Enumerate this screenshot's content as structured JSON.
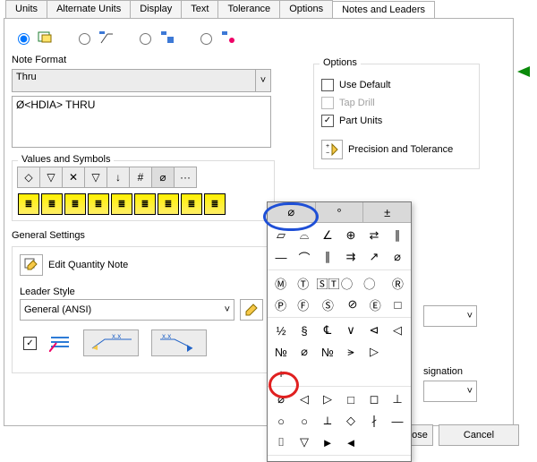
{
  "tabs": [
    "Units",
    "Alternate Units",
    "Display",
    "Text",
    "Tolerance",
    "Options",
    "Notes and Leaders"
  ],
  "active_tab": 6,
  "noteFormat": {
    "legend": "Note Format",
    "value": "Thru",
    "multiline": "Ø<HDIA> THRU"
  },
  "valuesSymbols": {
    "legend": "Values and Symbols",
    "top": [
      "◇",
      "▽",
      "✕",
      "▽",
      "↓",
      "#",
      "⌀",
      "···"
    ],
    "yellow": [
      "≡",
      "≡",
      "≡",
      "≡",
      "≡",
      "≡",
      "≡",
      "≡",
      "≡"
    ]
  },
  "generalSettings": {
    "legend": "General Settings",
    "editQty": "Edit Quantity Note",
    "leaderStyleLabel": "Leader Style",
    "leaderStyleValue": "General (ANSI)",
    "arrow1": "x.x",
    "arrow2": "x.x"
  },
  "options": {
    "legend": "Options",
    "useDefault": "Use Default",
    "tapDrill": "Tap Drill",
    "partUnits": "Part Units",
    "precTol": "Precision and Tolerance"
  },
  "palette": {
    "tabs": [
      "⌀",
      "°",
      "±"
    ],
    "rows": [
      [
        "▱",
        "⌓",
        "∠",
        "⊕",
        "⇄",
        "∥"
      ],
      [
        "—",
        "⌒",
        "∥",
        "⇉",
        "↗",
        "⌀"
      ],
      [
        "Ⓜ",
        "Ⓣ",
        "🅂🅃",
        "⃝",
        "⃝",
        "Ⓡ"
      ],
      [
        "Ⓟ",
        "Ⓕ",
        "Ⓢ",
        "⊘",
        "Ⓔ",
        "□"
      ],
      [
        "½",
        "§",
        "℄",
        "∨",
        "⊲",
        "◁"
      ],
      [
        "№",
        "⌀",
        "№",
        "⪫",
        "▷",
        ""
      ],
      [
        "+",
        "",
        "",
        "",
        "",
        ""
      ],
      [
        "⌀",
        "◁",
        "▷",
        "□",
        "◻",
        "⊥"
      ],
      [
        "○",
        "○",
        "⟂",
        "◇",
        "∤",
        "—"
      ],
      [
        "⌷",
        "▽",
        "►",
        "◄",
        "",
        ""
      ]
    ]
  },
  "truncated": {
    "signation": "signation"
  },
  "buttons": {
    "saveClose": "Save and Close",
    "cancel": "Cancel"
  }
}
